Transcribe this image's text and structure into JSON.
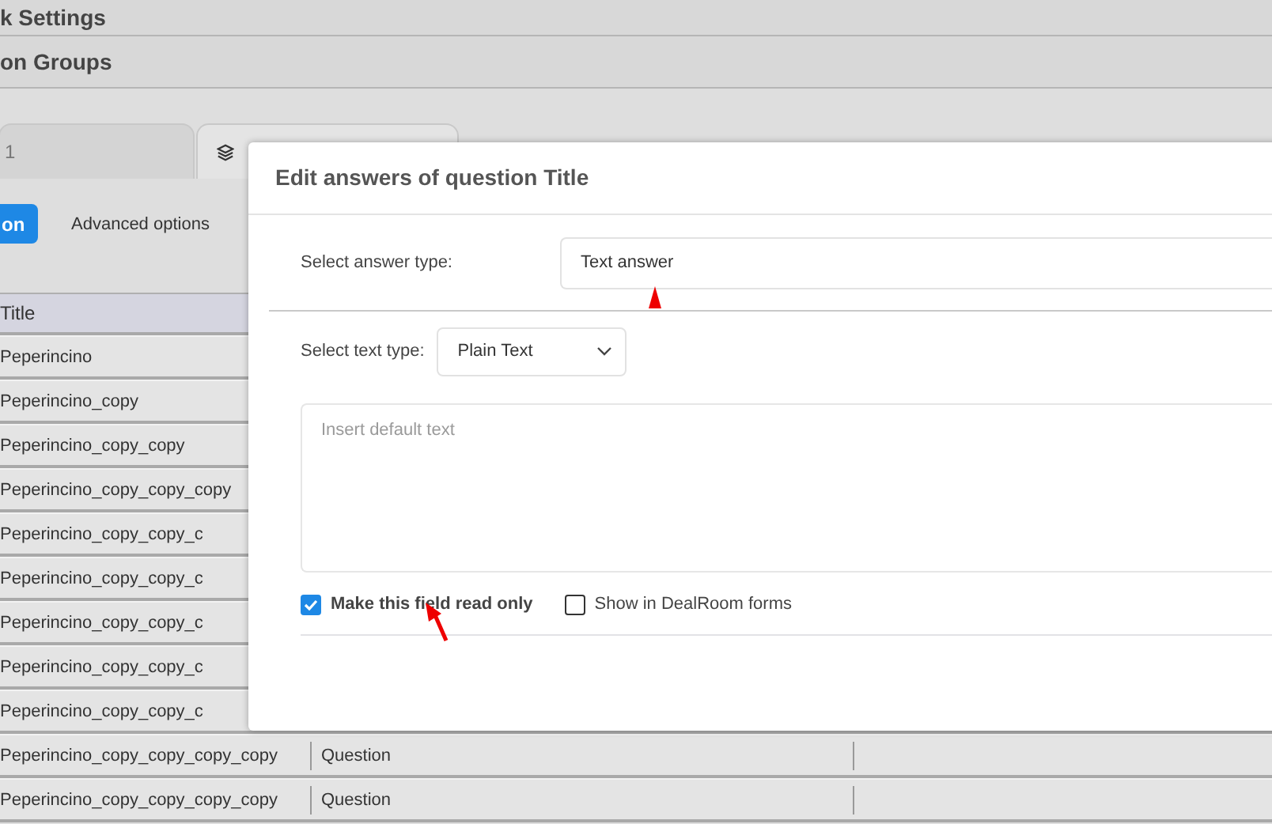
{
  "header_bars": [
    "k Settings",
    "on Groups"
  ],
  "tabs": [
    {
      "label": "1",
      "icon": false,
      "selected": false
    },
    {
      "icon": true,
      "selected": true
    }
  ],
  "toolbar": {
    "primary_button": "on",
    "links": [
      "Advanced options"
    ]
  },
  "table": {
    "columns": [
      "Title"
    ],
    "rows": [
      {
        "title": "Peperincino"
      },
      {
        "title": "Peperincino_copy"
      },
      {
        "title": "Peperincino_copy_copy"
      },
      {
        "title": "Peperincino_copy_copy_copy"
      },
      {
        "title": "Peperincino_copy_copy_c"
      },
      {
        "title": "Peperincino_copy_copy_c"
      },
      {
        "title": "Peperincino_copy_copy_c"
      },
      {
        "title": "Peperincino_copy_copy_c"
      },
      {
        "title": "Peperincino_copy_copy_c"
      },
      {
        "title": "Peperincino_copy_copy_copy_copy",
        "type": "Question"
      },
      {
        "title": "Peperincino_copy_copy_copy_copy",
        "type": "Question"
      }
    ]
  },
  "dialog": {
    "title": "Edit answers of question Title",
    "answer_type_label": "Select answer type:",
    "answer_type_value": "Text answer",
    "text_type_label": "Select text type:",
    "text_type_value": "Plain Text",
    "default_text": {
      "placeholder": "Insert default text"
    },
    "checkboxes": [
      {
        "label": "Make this field read only",
        "checked": true
      },
      {
        "label": "Show in DealRoom forms",
        "checked": false
      }
    ]
  }
}
